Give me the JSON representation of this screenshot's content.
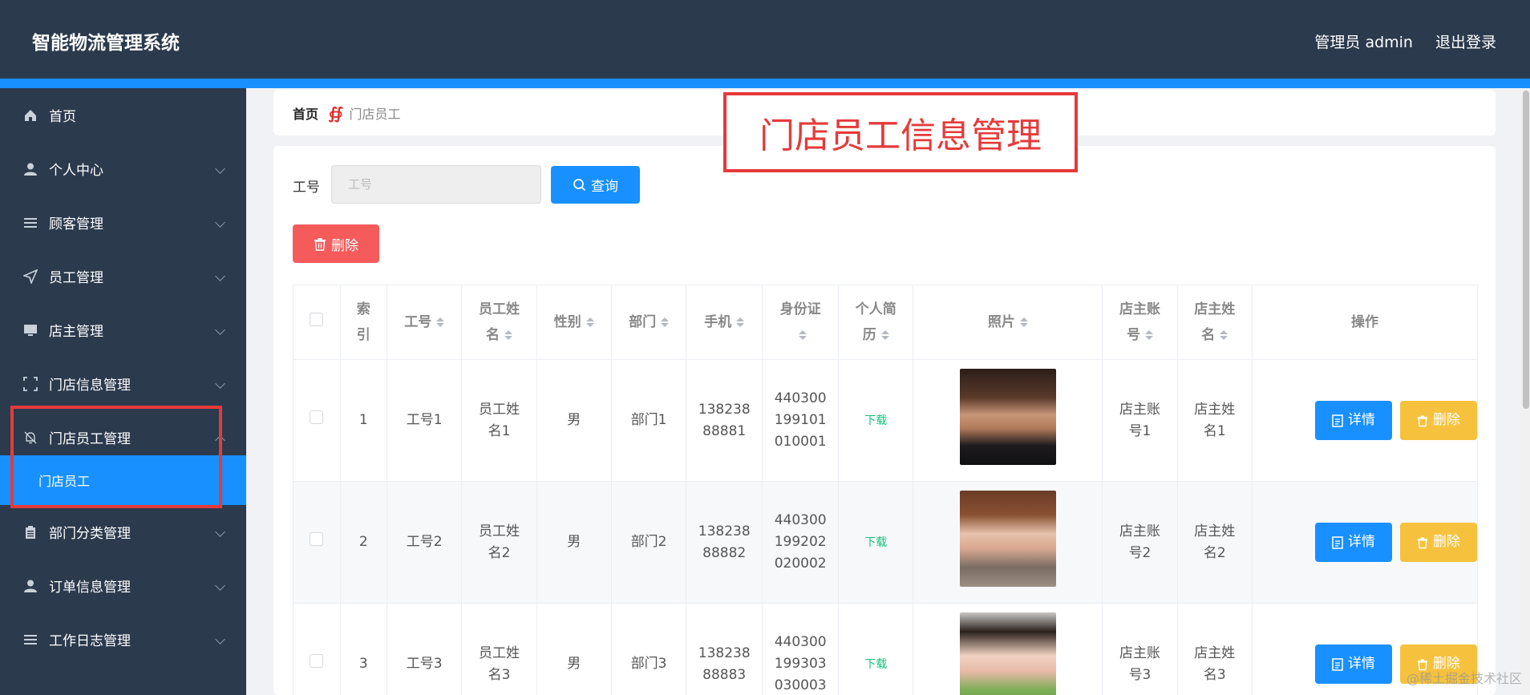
{
  "header": {
    "app_title": "智能物流管理系统",
    "user_label": "管理员 admin",
    "logout_label": "退出登录"
  },
  "sidebar": {
    "items": [
      {
        "label": "首页",
        "icon": "home-icon"
      },
      {
        "label": "个人中心",
        "icon": "user-icon"
      },
      {
        "label": "顾客管理",
        "icon": "list-icon"
      },
      {
        "label": "员工管理",
        "icon": "send-icon"
      },
      {
        "label": "店主管理",
        "icon": "monitor-icon"
      },
      {
        "label": "门店信息管理",
        "icon": "frame-icon"
      },
      {
        "label": "门店员工管理",
        "icon": "bell-off-icon"
      },
      {
        "label": "部门分类管理",
        "icon": "clipboard-icon"
      },
      {
        "label": "订单信息管理",
        "icon": "user-icon"
      },
      {
        "label": "工作日志管理",
        "icon": "list-icon"
      }
    ],
    "submenu_label": "门店员工"
  },
  "breadcrumb": {
    "home": "首页",
    "separator": "∯",
    "current": "门店员工"
  },
  "annotation_title": "门店员工信息管理",
  "search": {
    "label": "工号",
    "placeholder": "工号",
    "query_label": "查询"
  },
  "actions": {
    "delete_label": "删除"
  },
  "table": {
    "headers": {
      "index": [
        "索",
        "引"
      ],
      "emp_no": "工号",
      "emp_name": [
        "员工姓",
        "名"
      ],
      "gender": "性别",
      "dept": "部门",
      "phone": "手机",
      "id_card": [
        "身份证",
        ""
      ],
      "resume": [
        "个人简",
        "历"
      ],
      "photo": "照片",
      "owner_account": [
        "店主账",
        "号"
      ],
      "owner_name": [
        "店主姓",
        "名"
      ],
      "ops": "操作"
    },
    "rows": [
      {
        "index": "1",
        "emp_no": "工号1",
        "emp_name": [
          "员工姓",
          "名1"
        ],
        "gender": "男",
        "dept": "部门1",
        "phone": [
          "138238",
          "88881"
        ],
        "id_card": [
          "440300",
          "199101",
          "010001"
        ],
        "resume": "下载",
        "owner_account": [
          "店主账",
          "号1"
        ],
        "owner_name": [
          "店主姓",
          "名1"
        ]
      },
      {
        "index": "2",
        "emp_no": "工号2",
        "emp_name": [
          "员工姓",
          "名2"
        ],
        "gender": "男",
        "dept": "部门2",
        "phone": [
          "138238",
          "88882"
        ],
        "id_card": [
          "440300",
          "199202",
          "020002"
        ],
        "resume": "下载",
        "owner_account": [
          "店主账",
          "号2"
        ],
        "owner_name": [
          "店主姓",
          "名2"
        ]
      },
      {
        "index": "3",
        "emp_no": "工号3",
        "emp_name": [
          "员工姓",
          "名3"
        ],
        "gender": "男",
        "dept": "部门3",
        "phone": [
          "138238",
          "88883"
        ],
        "id_card": [
          "440300",
          "199303",
          "030003"
        ],
        "resume": "下载",
        "owner_account": [
          "店主账",
          "号3"
        ],
        "owner_name": [
          "店主姓",
          "名3"
        ]
      }
    ],
    "detail_label": "详情",
    "row_delete_label": "删除"
  },
  "watermark": "@稀土掘金技术社区",
  "colors": {
    "header_bg": "#2b3a4d",
    "accent": "#1890ff",
    "danger": "#f55b5b",
    "warning": "#f6c23e",
    "highlight_box": "#e53a3a"
  }
}
